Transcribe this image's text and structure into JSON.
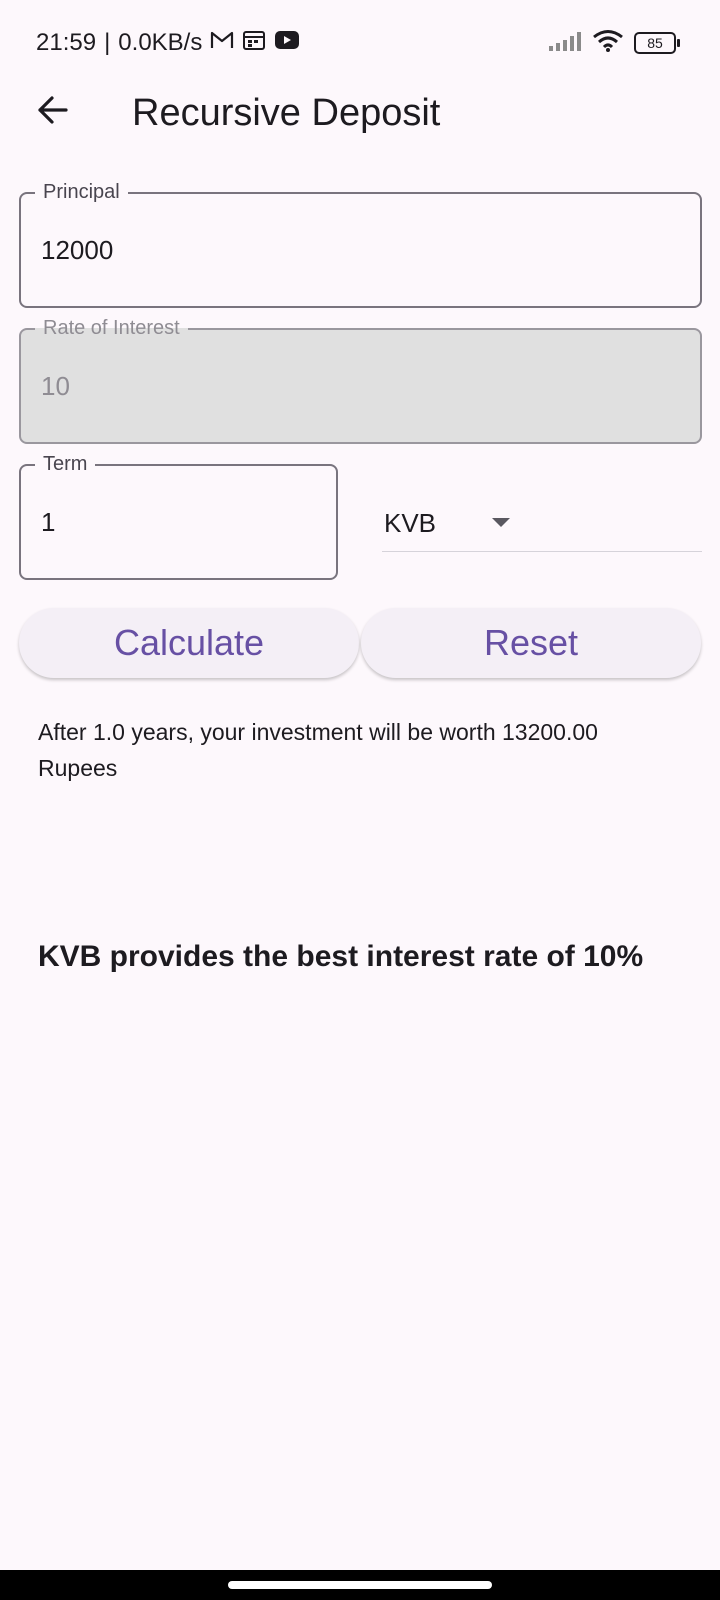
{
  "status_bar": {
    "time": "21:59",
    "network_speed": "0.0KB/s",
    "notification_icons": [
      "gmail-icon",
      "calendar-icon",
      "youtube-icon"
    ],
    "battery": "85"
  },
  "app_bar": {
    "title": "Recursive Deposit"
  },
  "form": {
    "principal": {
      "label": "Principal",
      "value": "12000"
    },
    "rate": {
      "label": "Rate of Interest",
      "value": "10",
      "disabled": true
    },
    "term": {
      "label": "Term",
      "value": "1"
    },
    "bank": {
      "selected": "KVB"
    }
  },
  "buttons": {
    "calculate": "Calculate",
    "reset": "Reset"
  },
  "result": {
    "text": "After 1.0 years, your investment will be worth 13200.00 Rupees",
    "best_rate": "KVB provides the best interest rate of 10%"
  },
  "colors": {
    "accent": "#6750a4",
    "background": "#fdf8fc",
    "disabled_fill": "#e0e0e0"
  }
}
